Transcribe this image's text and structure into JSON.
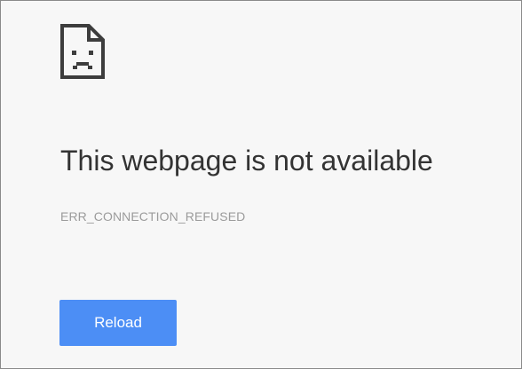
{
  "error_page": {
    "icon": "sad-page-icon",
    "title": "This webpage is not available",
    "error_code": "ERR_CONNECTION_REFUSED",
    "reload_label": "Reload"
  },
  "colors": {
    "background": "#f7f7f7",
    "title_text": "#333333",
    "error_code_text": "#9b9b9b",
    "button_background": "#4c8ef5",
    "button_text": "#ffffff",
    "icon": "#3d3d3d"
  }
}
